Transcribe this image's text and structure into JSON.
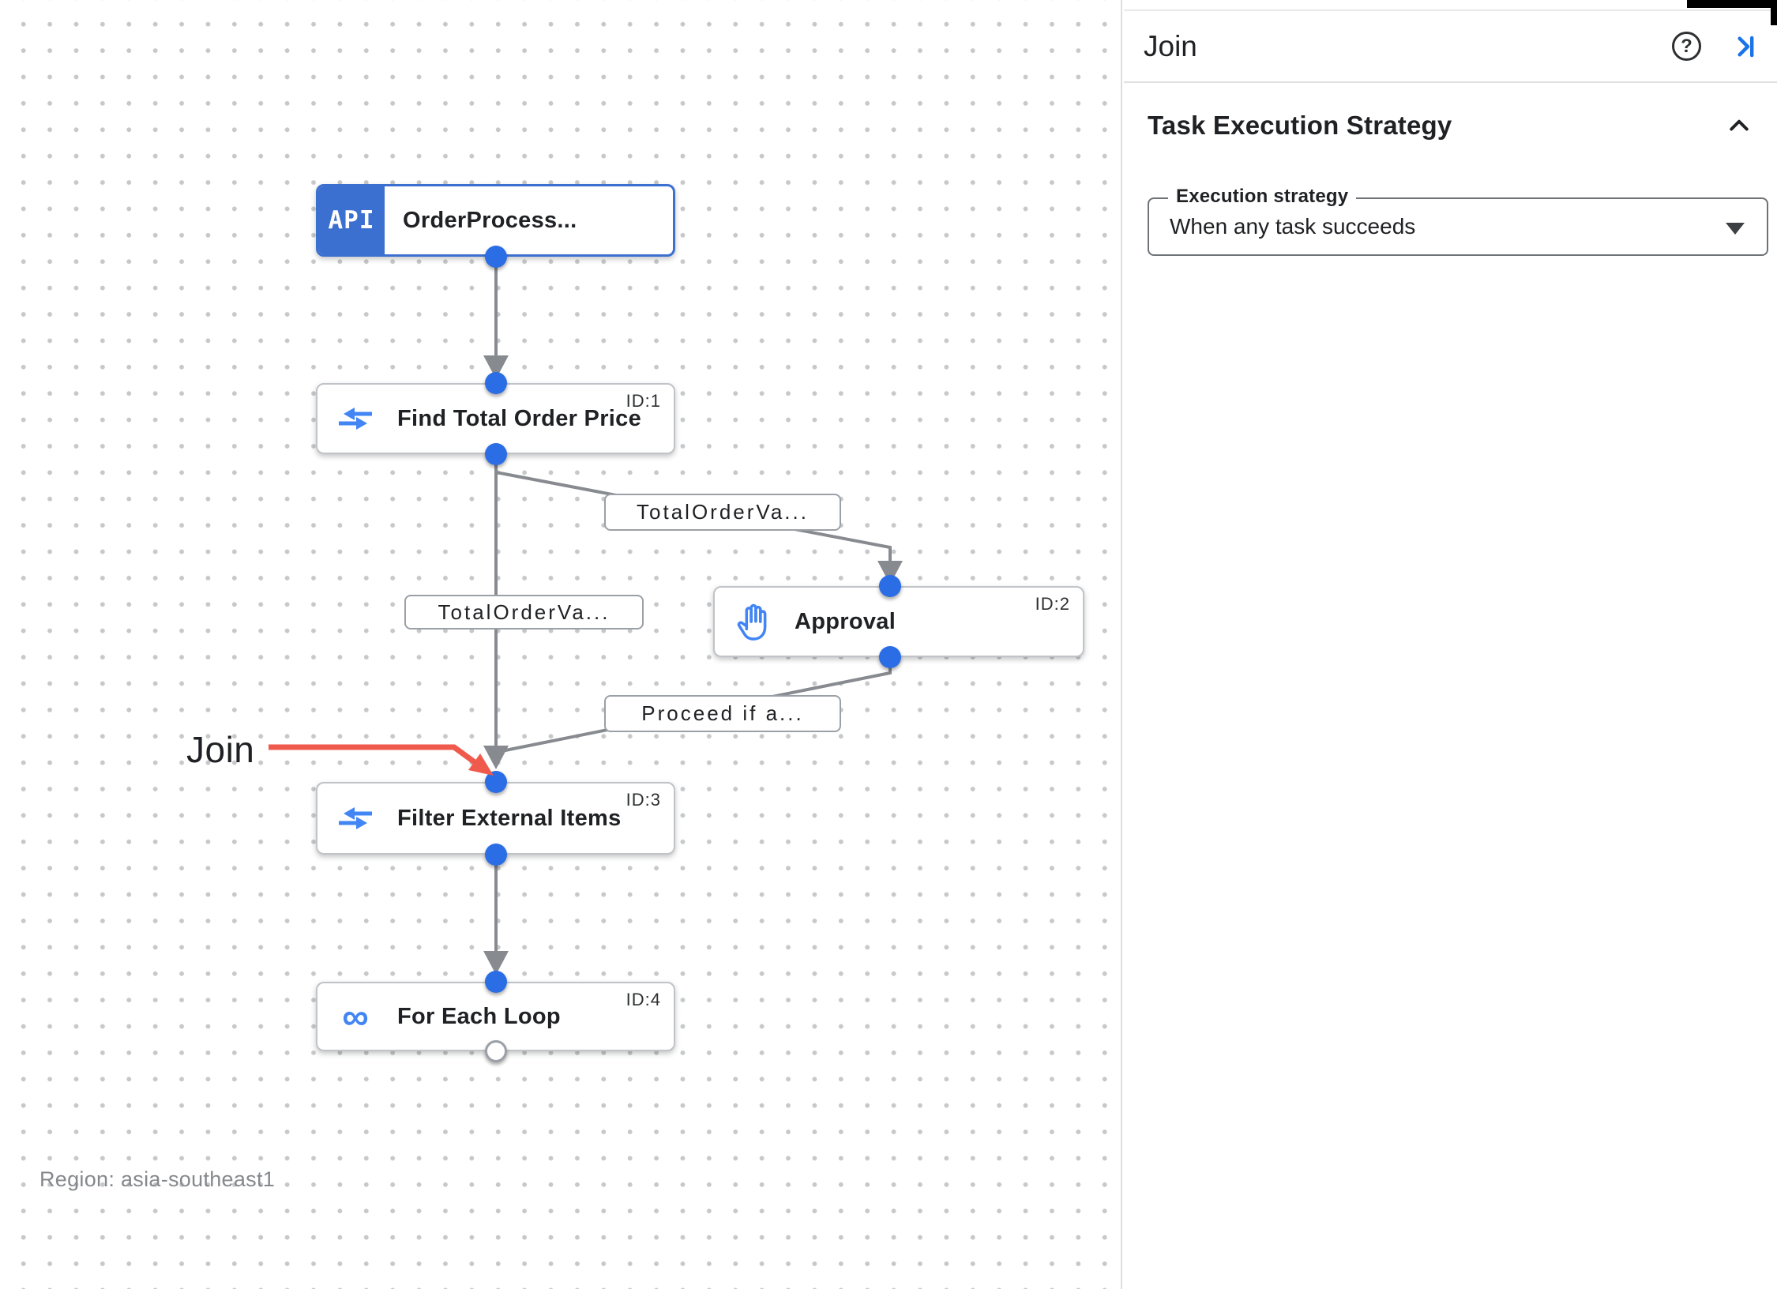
{
  "panel": {
    "title": "Join",
    "help_glyph": "?",
    "section_title": "Task Execution Strategy",
    "field_label": "Execution strategy",
    "field_value": "When any task succeeds"
  },
  "canvas": {
    "region_label": "Region: asia-southeast1",
    "annotation_label": "Join",
    "loop_icon_glyph": "∞",
    "nodes": [
      {
        "badge": "API",
        "title": "OrderProcess...",
        "id": ""
      },
      {
        "title": "Find Total Order Price",
        "id": "ID:1"
      },
      {
        "title": "Approval",
        "id": "ID:2"
      },
      {
        "title": "Filter External Items",
        "id": "ID:3"
      },
      {
        "title": "For Each Loop",
        "id": "ID:4"
      }
    ],
    "edge_labels": [
      {
        "text": "TotalOrderVa..."
      },
      {
        "text": "TotalOrderVa..."
      },
      {
        "text": "Proceed if a..."
      }
    ]
  },
  "colors": {
    "accent_blue": "#1a73e8",
    "node_header_blue": "#3c70d0",
    "port_blue": "#2b6de4",
    "edge_gray": "#878b90",
    "annotation_red": "#ef5a4c"
  }
}
